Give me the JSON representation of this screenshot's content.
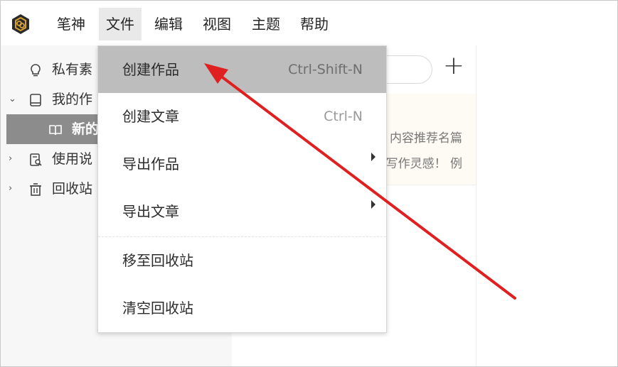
{
  "menubar": {
    "logo_icon": "hexagon-logo-icon",
    "items": [
      {
        "label": "笔神"
      },
      {
        "label": "文件"
      },
      {
        "label": "编辑"
      },
      {
        "label": "视图"
      },
      {
        "label": "主题"
      },
      {
        "label": "帮助"
      }
    ],
    "active_index": 1
  },
  "sidebar": {
    "items": [
      {
        "label": "私有素",
        "icon": "lightbulb-icon",
        "expandable": false
      },
      {
        "label": "我的作",
        "icon": "book-icon",
        "expandable": true,
        "expanded": true
      },
      {
        "label": "新的",
        "icon": "open-book-icon",
        "selected": true
      },
      {
        "label": "使用说",
        "icon": "document-search-icon",
        "expandable": true
      },
      {
        "label": "回收站",
        "icon": "trash-icon",
        "expandable": true
      }
    ]
  },
  "middle": {
    "add_label": "+",
    "hint_lines": [
      "内容推荐名篇",
      "写作灵感！ 例"
    ]
  },
  "file_menu": {
    "items": [
      {
        "label": "创建作品",
        "shortcut": "Ctrl-Shift-N",
        "hovered": true
      },
      {
        "label": "创建文章",
        "shortcut": "Ctrl-N"
      },
      {
        "label": "导出作品",
        "submenu": true
      },
      {
        "label": "导出文章",
        "submenu": true
      },
      {
        "label": "移至回收站"
      },
      {
        "label": "清空回收站"
      }
    ]
  },
  "colors": {
    "annotation_arrow": "#e02020",
    "hover_bg": "#bdbdbd",
    "selected_sidebar_bg": "#8c8c8c",
    "logo_gold": "#d4a032"
  }
}
